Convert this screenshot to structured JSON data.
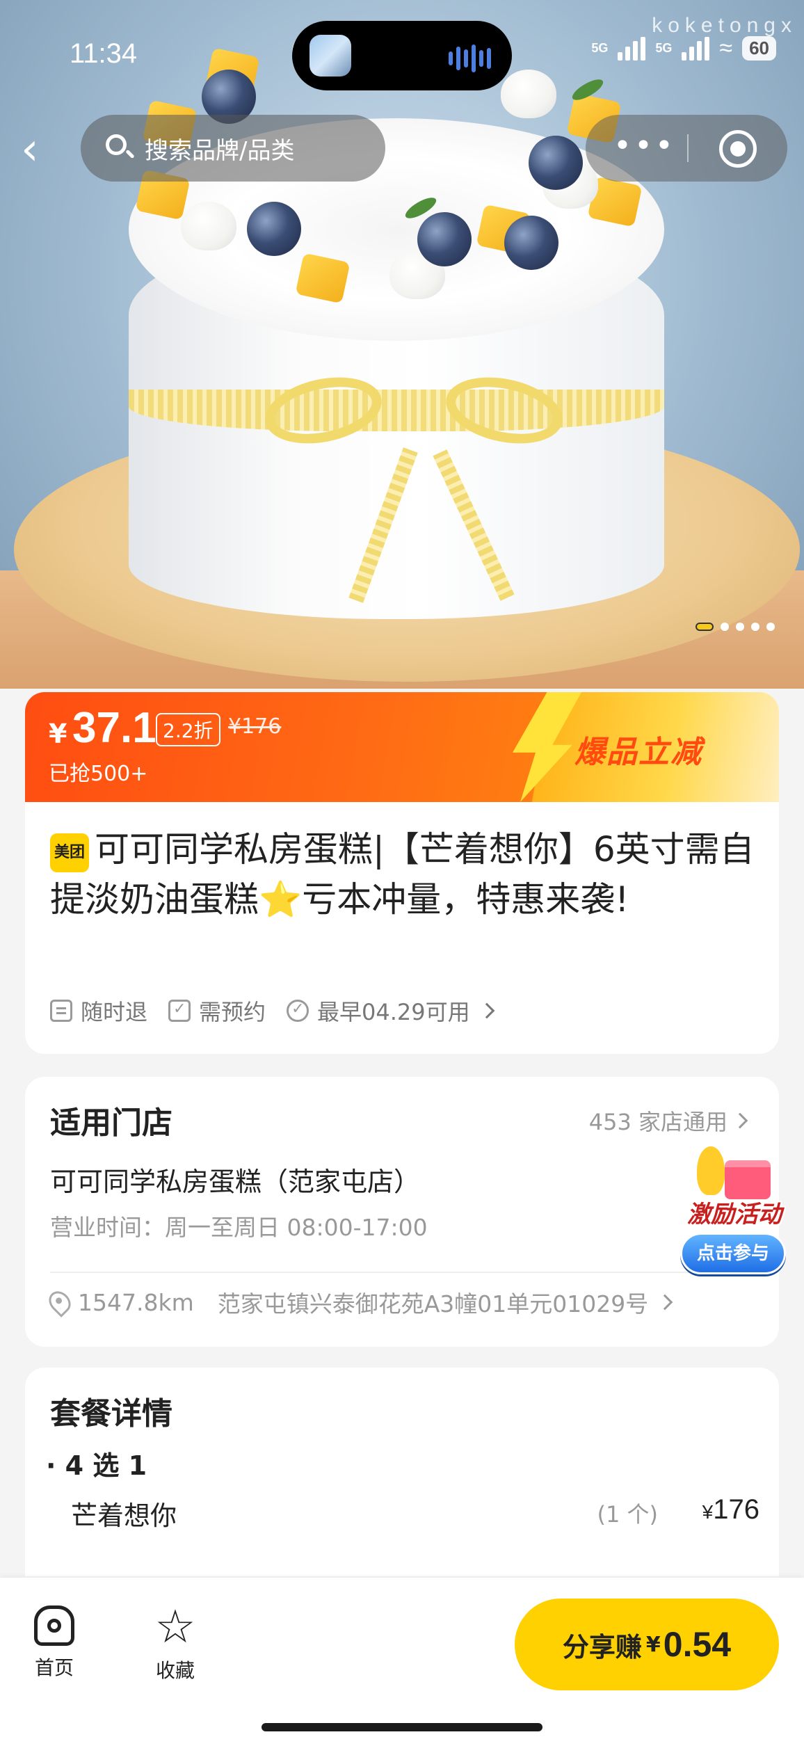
{
  "status": {
    "time": "11:34",
    "net1": "5G",
    "net2": "5G",
    "battery": "60"
  },
  "watermark": "koketongx",
  "topnav": {
    "search_placeholder": "搜索品牌/品类",
    "more_label": "•••"
  },
  "gallery": {
    "total": 5,
    "current": 1
  },
  "price": {
    "currency": "¥",
    "current": "37.1",
    "discount": "2.2折",
    "original": "¥176",
    "sold": "已抢500+",
    "promo": "爆品立减",
    "colors": {
      "banner": "#ff5a12",
      "promo_text": "#ff4a10"
    }
  },
  "product": {
    "brand_badge": "美团",
    "title": "可可同学私房蛋糕|【芒着想你】6英寸需自提淡奶油蛋糕⭐亏本冲量，特惠来袭!",
    "tags": [
      "随时退",
      "需预约",
      "最早04.29可用"
    ]
  },
  "store": {
    "section_title": "适用门店",
    "count_text": "453 家店通用",
    "name": "可可同学私房蛋糕（范家屯店）",
    "hours": "营业时间：周一至周日 08:00-17:00",
    "distance": "1547.8km",
    "address": "范家屯镇兴泰御花苑A3幢01单元01029号"
  },
  "activity": {
    "label": "激励活动",
    "button": "点击参与"
  },
  "package": {
    "section_title": "套餐详情",
    "group": "4 选 1",
    "items": [
      {
        "name": "芒着想你",
        "qty": "(1 个)",
        "price": "176"
      }
    ]
  },
  "bottom": {
    "home_label": "首页",
    "fav_label": "收藏",
    "share_label": "分享赚",
    "share_currency": "¥",
    "share_amount": "0.54",
    "accent": "#ffd100"
  }
}
